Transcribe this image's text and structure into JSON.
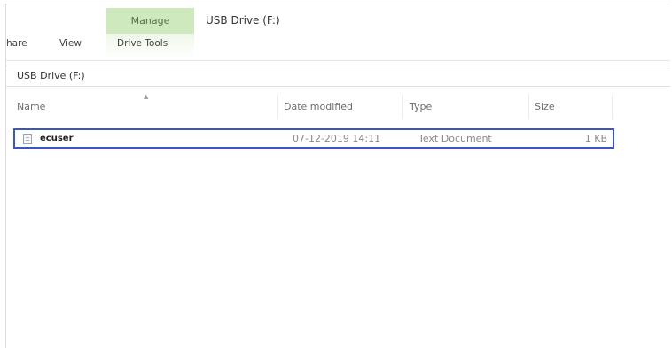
{
  "ribbon": {
    "manage_tab": "Manage",
    "title": "USB Drive (F:)",
    "tabs": [
      {
        "label": "hare"
      },
      {
        "label": "View"
      },
      {
        "label": "Drive Tools"
      }
    ]
  },
  "address": {
    "path": "USB Drive (F:)"
  },
  "list": {
    "columns": [
      "Name",
      "Date modified",
      "Type",
      "Size"
    ],
    "rows": [
      {
        "icon": "text-file-icon",
        "name": "ecuser",
        "date_modified": "07-12-2019 14:11",
        "type": "Text Document",
        "size": "1 KB",
        "selected": true
      }
    ]
  },
  "colors": {
    "manage_tab_bg": "#cfe9bf",
    "selection_border": "#3c55c6"
  }
}
